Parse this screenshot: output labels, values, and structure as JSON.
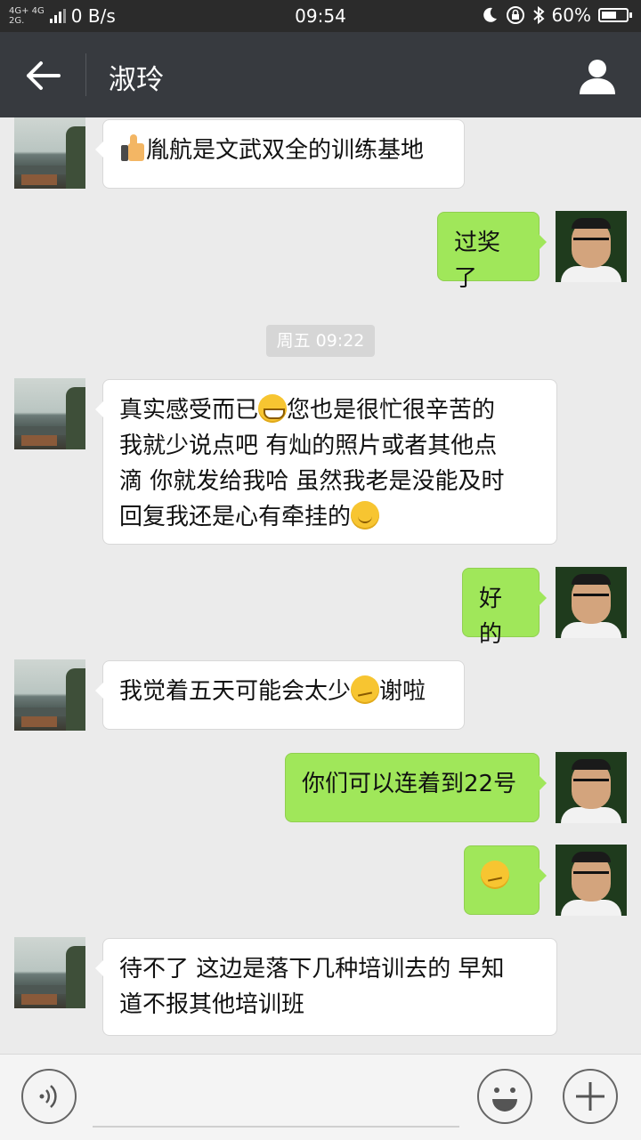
{
  "status_bar": {
    "network_top": "4G+ 4G",
    "network_bottom": "2G.",
    "net_speed": "0 B/s",
    "time": "09:54",
    "battery": "60%",
    "battery_level": 0.6
  },
  "header": {
    "title": "淑玲"
  },
  "messages": [
    {
      "side": "in",
      "text": "胤航是文武双全的训练基地",
      "lead_icon": "thumbs-up-emoji"
    },
    {
      "side": "out",
      "text": "过奖了"
    },
    {
      "timestamp": "周五 09:22"
    },
    {
      "side": "in",
      "parts": [
        "真实感受而已",
        "您也是很忙很辛苦的",
        "我就少说点吧 有灿的照片或者其他点",
        "滴 你就发给我哈 虽然我老是没能及时",
        "回复我还是心有牵挂的"
      ]
    },
    {
      "side": "out",
      "text": "好的"
    },
    {
      "side": "in",
      "parts": [
        "我觉着五天可能会太少",
        "谢啦"
      ]
    },
    {
      "side": "out",
      "text": "你们可以连着到22号"
    },
    {
      "side": "out",
      "emoji": "thinking-emoji"
    },
    {
      "side": "in",
      "parts": [
        "待不了 这边是落下几种培训去的 早知",
        "道不报其他培训班"
      ]
    }
  ],
  "icons": {
    "back": "arrow-left-icon",
    "profile": "person-icon",
    "voice": "voice-icon",
    "emoji": "smiley-icon",
    "more": "plus-icon"
  },
  "colors": {
    "title_bar": "#373a3f",
    "status_bar": "#2b2b2b",
    "outgoing_bubble": "#a0e75a",
    "incoming_bubble": "#ffffff",
    "chat_bg": "#ebebeb"
  }
}
